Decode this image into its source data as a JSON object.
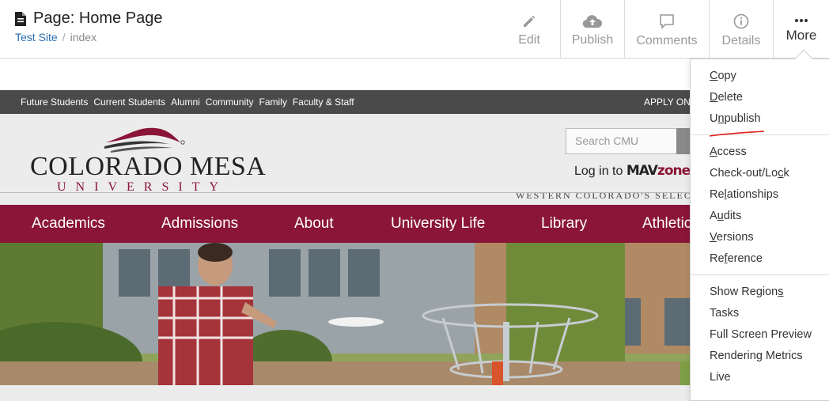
{
  "header": {
    "page_title": "Page: Home Page",
    "breadcrumb": {
      "site": "Test Site",
      "separator": "/",
      "current": "index"
    }
  },
  "toolbar": {
    "edit": "Edit",
    "publish": "Publish",
    "comments": "Comments",
    "details": "Details",
    "more": "More"
  },
  "dropdown": {
    "group1": [
      {
        "label": "Copy"
      },
      {
        "label": "Delete"
      },
      {
        "label": "Unpublish"
      }
    ],
    "group2": [
      {
        "label": "Access"
      },
      {
        "label": "Check-out/Lock"
      },
      {
        "label": "Relationships"
      },
      {
        "label": "Audits"
      },
      {
        "label": "Versions"
      },
      {
        "label": "Reference"
      }
    ],
    "group3": [
      {
        "label": "Show Regions"
      },
      {
        "label": "Tasks"
      },
      {
        "label": "Full Screen Preview"
      },
      {
        "label": "Rendering Metrics"
      },
      {
        "label": "Live"
      }
    ]
  },
  "site": {
    "utility_links": [
      "Future Students",
      "Current Students",
      "Alumni",
      "Community",
      "Family",
      "Faculty & Staff"
    ],
    "apply_online": "APPLY ONLINE",
    "logo_word": "COLORADO MESA",
    "logo_sub": "UNIVERSITY",
    "search_placeholder": "Search CMU",
    "login_prefix": "Log in to",
    "login_brand_a": "MAV",
    "login_brand_b": "zone",
    "tagline": "WESTERN COLORADO'S SELECTIVE",
    "nav": [
      "Academics",
      "Admissions",
      "About",
      "University Life",
      "Library",
      "Athletics"
    ]
  },
  "colors": {
    "brand": "#8a1538",
    "utility_bar": "#4a4a4a",
    "link": "#2a6db0"
  }
}
